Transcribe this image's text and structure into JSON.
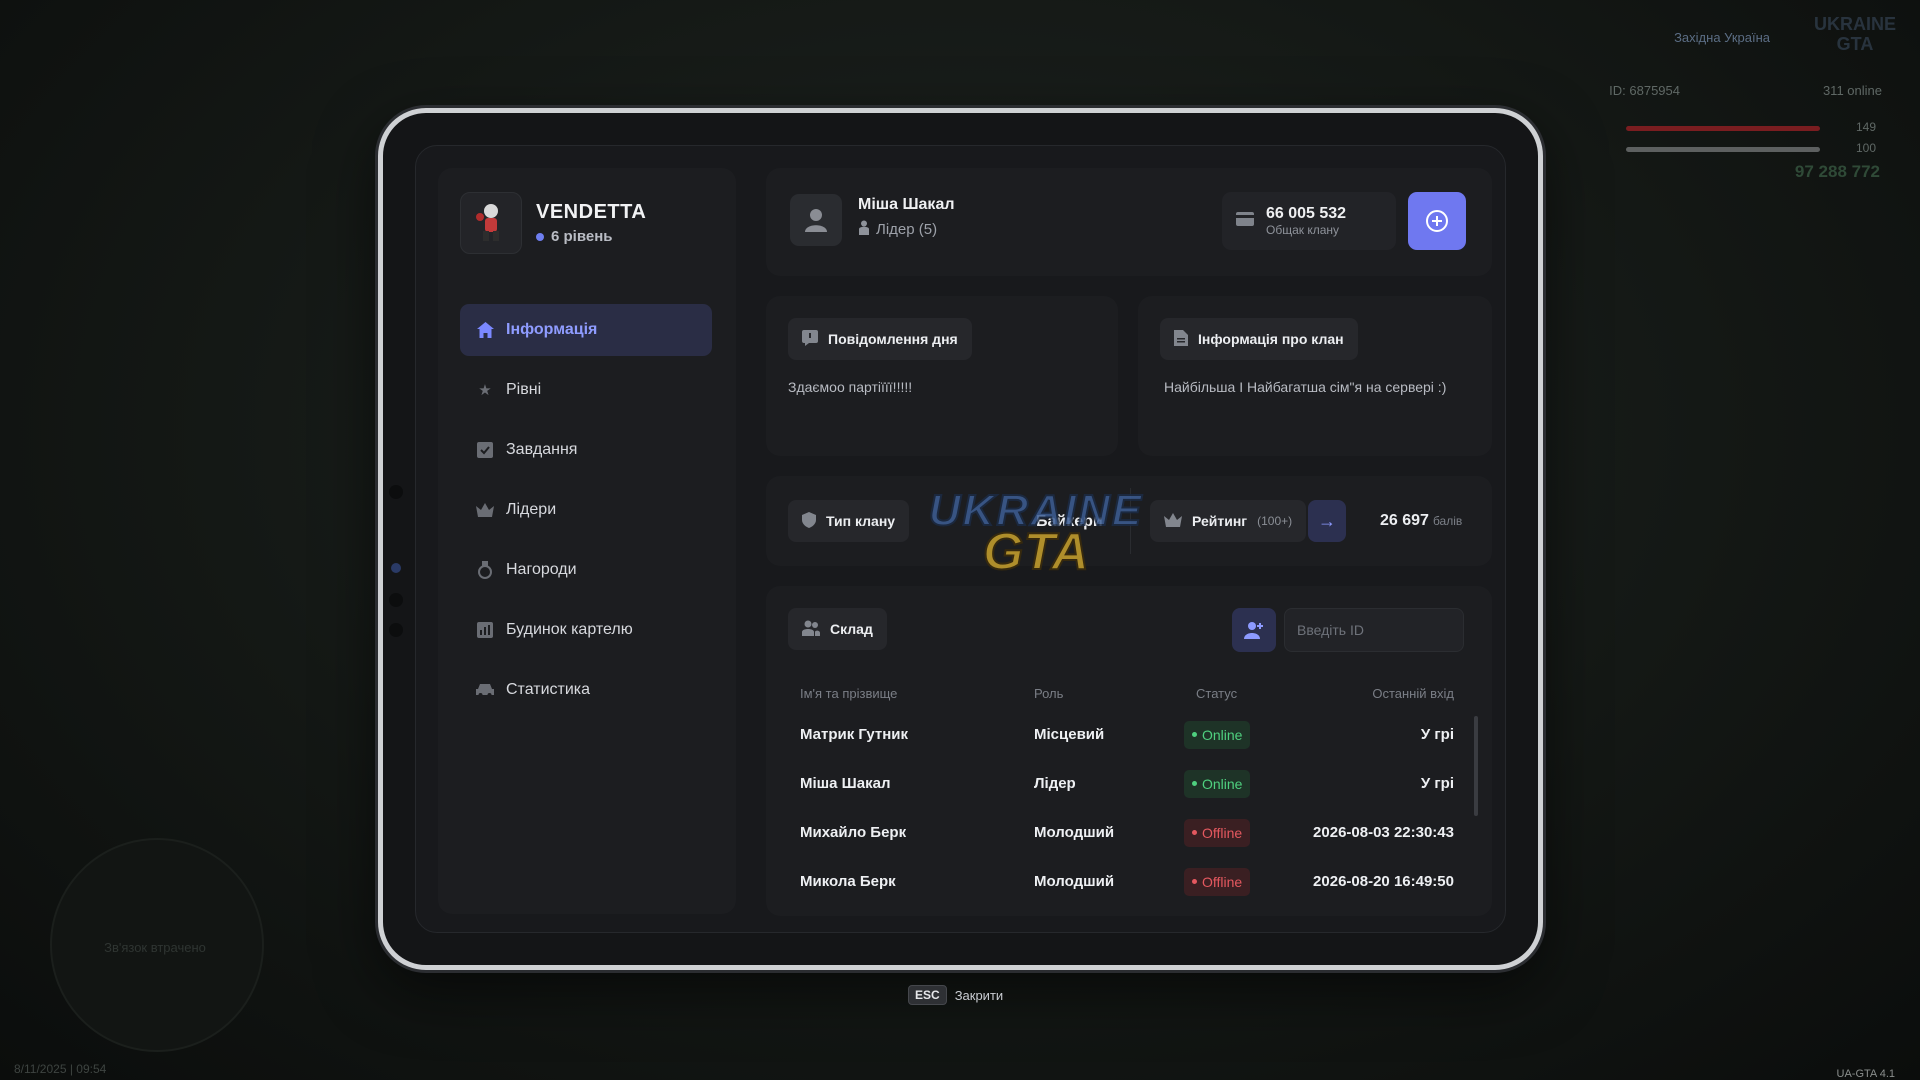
{
  "hud": {
    "region": "Західна Україна",
    "logo_text": "UKRAINE GTA",
    "player_id": "ID: 6875954",
    "online": "311 online",
    "health": "149",
    "armor": "100",
    "money": "97 288 772",
    "version": "UA-GTA 4.1",
    "time": "8/11/2025 | 09:54",
    "minimap_text": "Зв'язок втрачено"
  },
  "clan": {
    "name": "VENDETTA",
    "level": "6 рівень"
  },
  "nav": [
    {
      "label": "Інформація",
      "icon": "home-icon"
    },
    {
      "label": "Рівні",
      "icon": "star-icon"
    },
    {
      "label": "Завдання",
      "icon": "checkbox-icon"
    },
    {
      "label": "Лідери",
      "icon": "crown-icon"
    },
    {
      "label": "Нагороди",
      "icon": "medal-icon"
    },
    {
      "label": "Будинок картелю",
      "icon": "chart-icon"
    },
    {
      "label": "Статистика",
      "icon": "car-icon"
    }
  ],
  "profile": {
    "name": "Міша Шакал",
    "role": "Лідер (5)",
    "bank_value": "66 005 532",
    "bank_label": "Общак клану"
  },
  "motd": {
    "title": "Повідомлення дня",
    "text": "Здаємоо партіїїї!!!!!"
  },
  "clan_info": {
    "title": "Інформація про клан",
    "text": "Найбільша І Найбагатша сім\"я на сервері :)"
  },
  "clan_type": {
    "label": "Тип клану",
    "value": "Байкери"
  },
  "rating": {
    "label": "Рейтинг",
    "sub": "(100+)",
    "points": "26 697",
    "points_unit": "балів"
  },
  "roster": {
    "title": "Склад",
    "id_placeholder": "Введіть ID",
    "columns": [
      "Ім'я та прізвище",
      "Роль",
      "Статус",
      "Останній вхід"
    ],
    "rows": [
      {
        "name": "Матрик Гутник",
        "role": "Місцевий",
        "status": "Online",
        "last": "У грі"
      },
      {
        "name": "Міша Шакал",
        "role": "Лідер",
        "status": "Online",
        "last": "У грі"
      },
      {
        "name": "Михайло Берк",
        "role": "Молодший",
        "status": "Offline",
        "last": "2026-08-03 22:30:43"
      },
      {
        "name": "Микола Берк",
        "role": "Молодший",
        "status": "Offline",
        "last": "2026-08-20 16:49:50"
      }
    ]
  },
  "footer": {
    "key": "ESC",
    "label": "Закрити"
  },
  "colors": {
    "accent": "#6f78f0",
    "online": "#4fd07f",
    "offline": "#e4585f"
  }
}
